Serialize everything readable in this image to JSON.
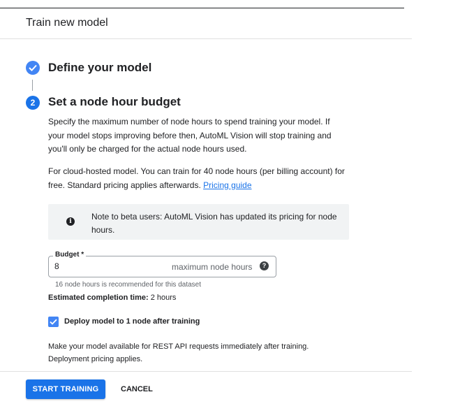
{
  "dialog": {
    "title": "Train new model"
  },
  "steps": [
    {
      "number": "",
      "title": "Define your model",
      "status": "complete",
      "icon": "check-circle-icon"
    },
    {
      "number": "2",
      "title": "Set a node hour budget",
      "status": "active"
    }
  ],
  "budget_step": {
    "description": "Specify the maximum number of node hours to spend training your model. If your model stops improving before then, AutoML Vision will stop training and you'll only be charged for the actual node hours used.",
    "cloud_text": "For cloud-hosted model. You can train for 40 node hours (per billing account) for free. Standard pricing applies afterwards.",
    "pricing_link": "Pricing guide",
    "note": {
      "icon": "info-icon",
      "text": "Note to beta users: AutoML Vision has updated its pricing for node hours."
    },
    "budget_field": {
      "label": "Budget *",
      "value": "8",
      "suffix": "maximum node hours",
      "help_icon": "help-icon",
      "hint": "16 node hours is recommended for this dataset"
    },
    "estimate": {
      "label": "Estimated completion time:",
      "value": "2 hours"
    },
    "deploy_checkbox": {
      "label": "Deploy model to 1 node after training",
      "checked": true
    },
    "deploy_text": "Make your model available for REST API requests immediately after training. Deployment pricing applies."
  },
  "actions": {
    "primary": "START TRAINING",
    "secondary": "CANCEL"
  },
  "colors": {
    "accent": "#1a73e8",
    "step_complete": "#4285f4",
    "note_bg": "#f1f3f4"
  }
}
